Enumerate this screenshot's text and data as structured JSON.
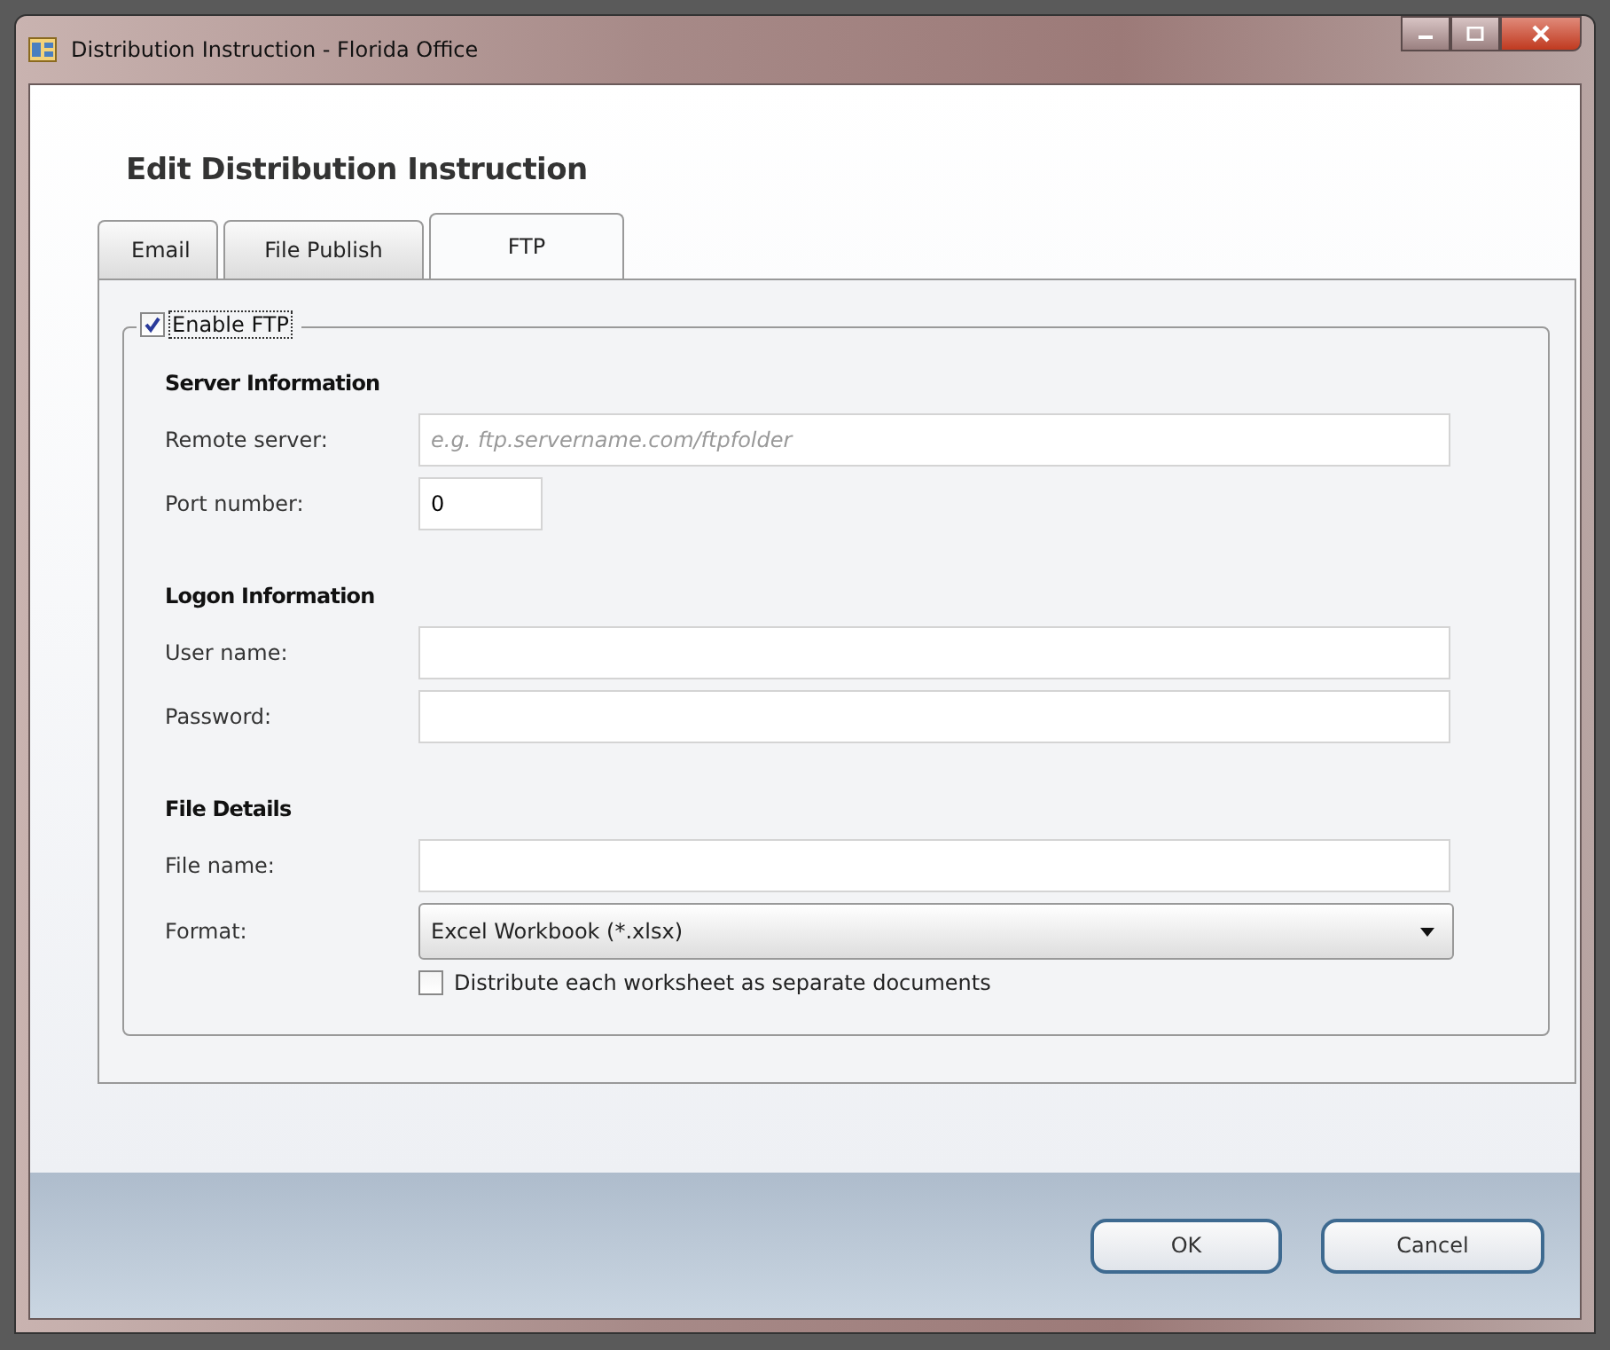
{
  "window": {
    "title": "Distribution Instruction - Florida Office"
  },
  "heading": "Edit Distribution Instruction",
  "tabs": [
    {
      "label": "Email",
      "selected": false
    },
    {
      "label": "File Publish",
      "selected": false
    },
    {
      "label": "FTP",
      "selected": true
    }
  ],
  "group": {
    "label": "Enable FTP",
    "checked": true
  },
  "sections": [
    {
      "title": "Server Information",
      "fields": [
        {
          "kind": "text",
          "label": "Remote server:",
          "placeholder": "e.g. ftp.servername.com/ftpfolder"
        },
        {
          "kind": "short",
          "label": "Port number:",
          "value": "0"
        }
      ]
    },
    {
      "title": "Logon Information",
      "fields": [
        {
          "kind": "text",
          "label": "User name:"
        },
        {
          "kind": "text",
          "label": "Password:"
        }
      ]
    },
    {
      "title": "File Details",
      "fields": [
        {
          "kind": "text",
          "label": "File name:"
        },
        {
          "kind": "dropdown",
          "label": "Format:",
          "value": "Excel Workbook (*.xlsx)"
        },
        {
          "kind": "checkbox",
          "label": "Distribute each worksheet as separate documents",
          "checked": false
        }
      ]
    }
  ],
  "buttons": [
    "OK",
    "Cancel"
  ]
}
